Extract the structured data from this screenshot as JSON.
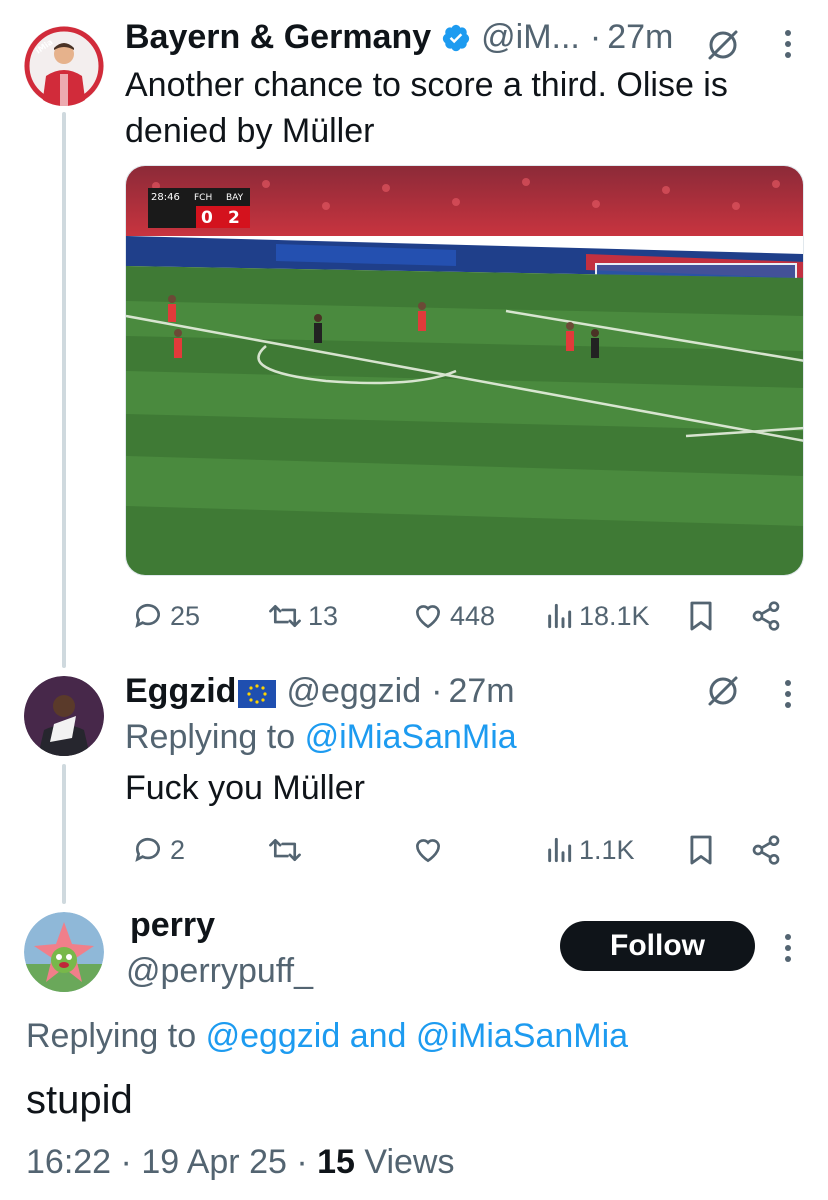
{
  "tweet1": {
    "name": "Bayern & Germany",
    "handle": "@iM...",
    "time": "27m",
    "text_line1": "Another chance to score a third. Olise is",
    "text_line2": "denied by Müller",
    "scoreboard": {
      "clock": "28:46",
      "home": "FCH",
      "away": "BAY",
      "home_score": "0",
      "away_score": "2"
    },
    "stats": {
      "replies": "25",
      "retweets": "13",
      "likes": "448",
      "views": "18.1K"
    }
  },
  "tweet2": {
    "name": "Eggzid",
    "handle": "@eggzid",
    "time": "27m",
    "replying_prefix": "Replying to",
    "replying_mention": "@iMiaSanMia",
    "text": "Fuck you Müller",
    "stats": {
      "replies": "2",
      "views": "1.1K"
    }
  },
  "tweet3": {
    "name": "perry",
    "handle": "@perrypuff_",
    "follow_label": "Follow",
    "replying_prefix": "Replying to",
    "replying_mention1": "@eggzid",
    "replying_and": "and",
    "replying_mention2": "@iMiaSanMia",
    "text": "stupid",
    "time": "16:22",
    "date": "19 Apr 25",
    "views_count": "15",
    "views_label": "Views"
  },
  "colors": {
    "accent": "#1d9bf0",
    "muted": "#536471",
    "text": "#0f1419",
    "pitch": "#3f7a35"
  },
  "icons": [
    "verified-badge-icon",
    "grok-icon",
    "more-icon",
    "reply-icon",
    "retweet-icon",
    "like-icon",
    "views-icon",
    "bookmark-icon",
    "share-icon"
  ]
}
